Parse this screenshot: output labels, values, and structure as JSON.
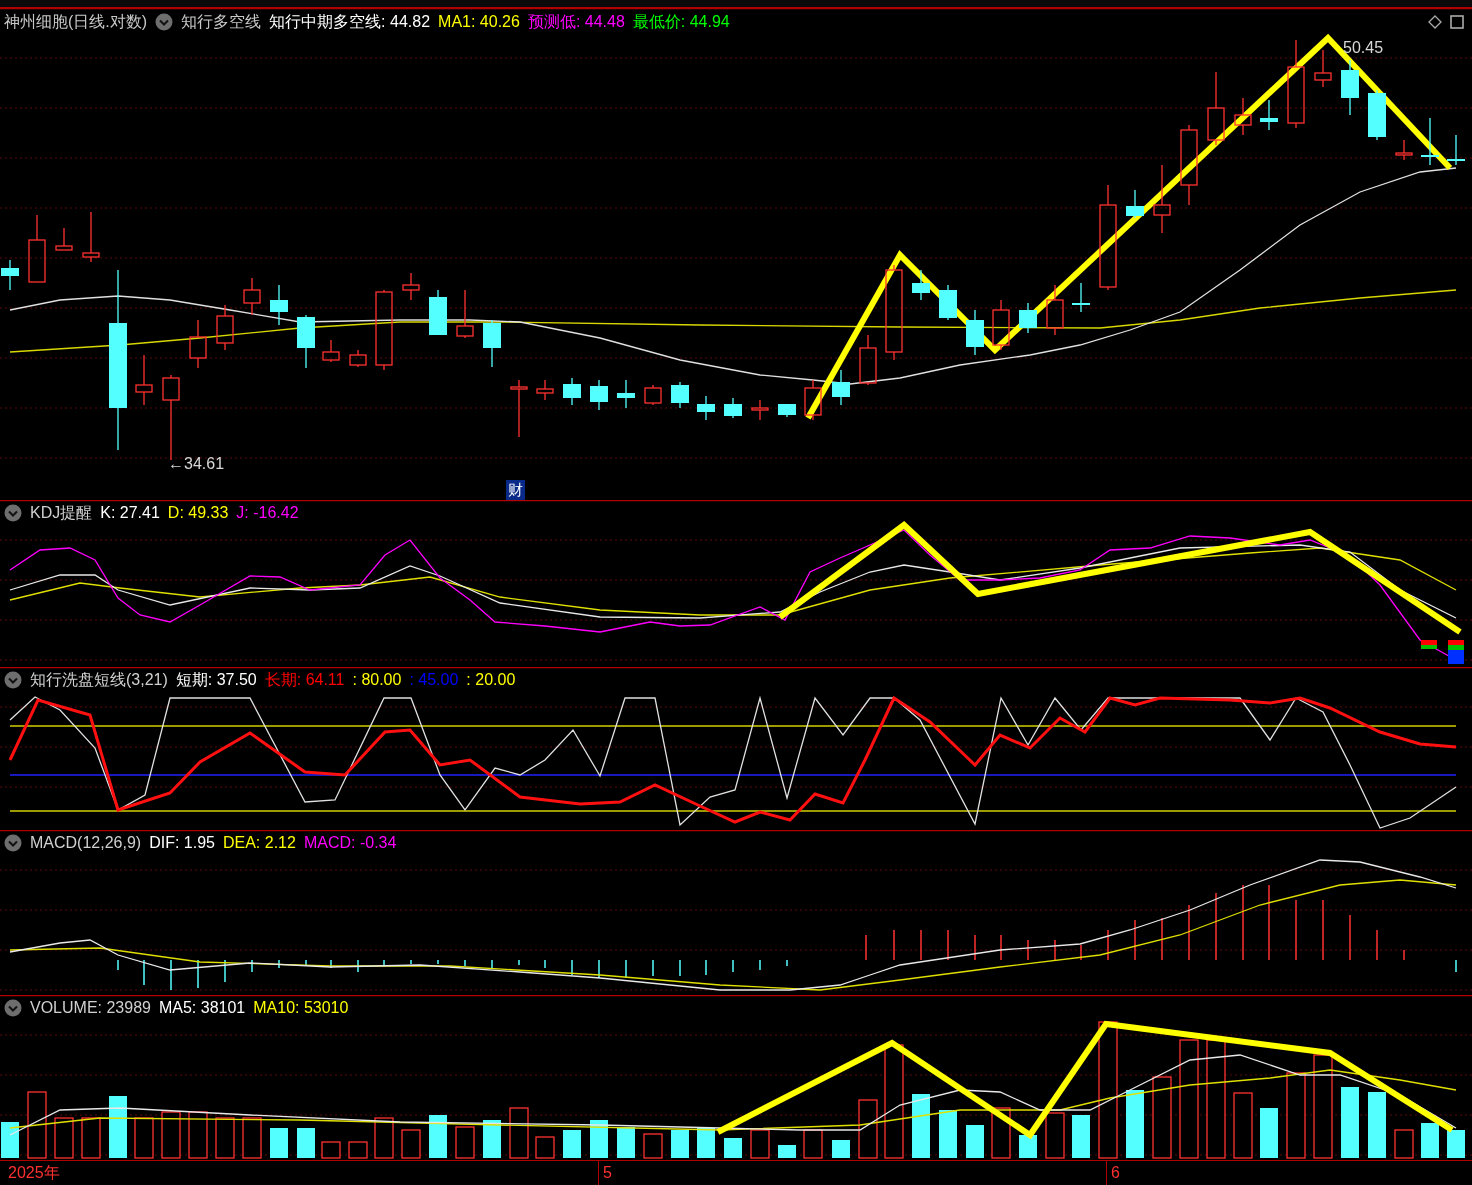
{
  "main": {
    "title": "神州细胞(日线.对数)",
    "indicator": "知行多空线",
    "readouts": [
      {
        "text": "知行中期多空线: 44.82",
        "color": "#ffffff"
      },
      {
        "text": "MA1: 40.26",
        "color": "#ffff00"
      },
      {
        "text": "预测低: 44.48",
        "color": "#ff00ff"
      },
      {
        "text": "最低价: 44.94",
        "color": "#00ff00"
      }
    ],
    "high_label": "50.45",
    "low_label": "←34.61",
    "finance_badge": "财"
  },
  "panels": [
    {
      "kind": "kdj",
      "title": "KDJ提醒",
      "readouts": [
        {
          "text": "K: 27.41",
          "color": "#ffffff"
        },
        {
          "text": "D: 49.33",
          "color": "#ffff00"
        },
        {
          "text": "J: -16.42",
          "color": "#ff00ff"
        }
      ]
    },
    {
      "kind": "wash",
      "title": "知行洗盘短线(3,21)",
      "readouts": [
        {
          "text": "短期: 37.50",
          "color": "#ffffff"
        },
        {
          "text": "长期: 64.11",
          "color": "#ff0000"
        },
        {
          "text": ": 80.00",
          "color": "#ffff00"
        },
        {
          "text": ": 45.00",
          "color": "#0000ff"
        },
        {
          "text": ": 20.00",
          "color": "#ffff00"
        }
      ]
    },
    {
      "kind": "macd",
      "title": "MACD(12,26,9)",
      "readouts": [
        {
          "text": "DIF: 1.95",
          "color": "#ffffff"
        },
        {
          "text": "DEA: 2.12",
          "color": "#ffff00"
        },
        {
          "text": "MACD: -0.34",
          "color": "#ff00ff"
        }
      ]
    },
    {
      "kind": "volume",
      "title": "VOLUME: 23989",
      "readouts": [
        {
          "text": "MA5: 38101",
          "color": "#ffffff"
        },
        {
          "text": "MA10: 53010",
          "color": "#ffff00"
        }
      ]
    }
  ],
  "x_axis": {
    "labels": [
      "2025年",
      "5",
      "6"
    ]
  }
}
